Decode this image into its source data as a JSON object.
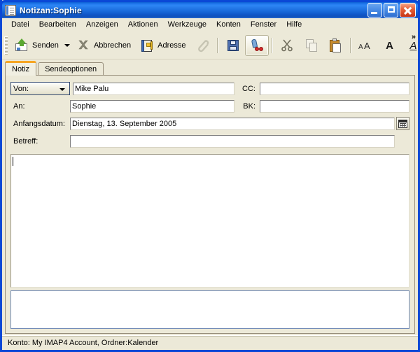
{
  "window": {
    "title": "Notizan:Sophie",
    "icon": "note-document-icon",
    "minimize_label": "Minimieren",
    "maximize_label": "Maximieren",
    "close_label": "Schließen"
  },
  "menubar": {
    "items": [
      {
        "label": "Datei"
      },
      {
        "label": "Bearbeiten"
      },
      {
        "label": "Anzeigen"
      },
      {
        "label": "Aktionen"
      },
      {
        "label": "Werkzeuge"
      },
      {
        "label": "Konten"
      },
      {
        "label": "Fenster"
      },
      {
        "label": "Hilfe"
      }
    ]
  },
  "toolbar": {
    "send_label": "Senden",
    "send_icon": "send-envelope-icon",
    "send_dropdown_icon": "chevron-down-icon",
    "cancel_label": "Abbrechen",
    "cancel_icon": "cancel-x-icon",
    "address_label": "Adresse",
    "address_icon": "address-book-icon",
    "attach_icon": "paperclip-icon",
    "save_icon": "save-floppy-icon",
    "spellcheck_icon": "spellcheck-icon",
    "cut_icon": "scissors-icon",
    "copy_icon": "copy-pages-icon",
    "paste_icon": "clipboard-paste-icon",
    "font_icon": "font-size-icon",
    "bold_icon": "bold-icon",
    "italic_icon": "italic-underline-icon",
    "overflow_label": "»"
  },
  "tabs": [
    {
      "label": "Notiz",
      "active": true
    },
    {
      "label": "Sendeoptionen",
      "active": false
    }
  ],
  "form": {
    "from": {
      "selector_value": "Von:",
      "selector_icon": "chevron-down-icon",
      "value": "Mike Palu",
      "placeholder": ""
    },
    "to": {
      "label": "An:",
      "value": "Sophie",
      "placeholder": ""
    },
    "cc": {
      "label": "CC:",
      "value": "",
      "placeholder": ""
    },
    "bcc": {
      "label": "BK:",
      "value": "",
      "placeholder": ""
    },
    "start_date": {
      "label": "Anfangsdatum:",
      "value": "Dienstag, 13. September 2005",
      "picker_icon": "calendar-icon",
      "placeholder": ""
    },
    "subject": {
      "label": "Betreff:",
      "value": "",
      "placeholder": ""
    },
    "body": {
      "value": "",
      "placeholder": ""
    },
    "attachments": {
      "value": "",
      "placeholder": ""
    }
  },
  "statusbar": {
    "text": "Konto: My IMAP4 Account,  Ordner:Kalender"
  },
  "colors": {
    "titlebar_blue": "#0b5fd4",
    "window_border": "#0a48d6",
    "face": "#ece9d8",
    "active_tab_accent": "#f6a623",
    "field_bg": "#ffffff",
    "attach_border": "#7089b5"
  }
}
